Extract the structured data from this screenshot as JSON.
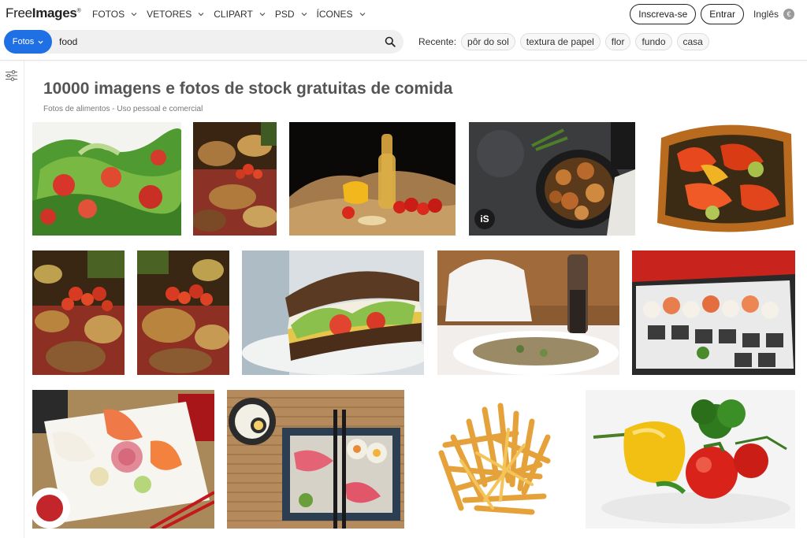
{
  "header": {
    "logo_light": "Free",
    "logo_bold": "Images",
    "logo_mark": "®",
    "nav": [
      {
        "label": "FOTOS",
        "has_menu": true
      },
      {
        "label": "VETORES",
        "has_menu": true
      },
      {
        "label": "CLIPART",
        "has_menu": true
      },
      {
        "label": "PSD",
        "has_menu": true
      },
      {
        "label": "ÍCONES",
        "has_menu": true
      }
    ],
    "signup_label": "Inscreva-se",
    "login_label": "Entrar",
    "language_label": "Inglês",
    "language_icon_glyph": "€"
  },
  "search": {
    "type_label": "Fotos",
    "query": "food",
    "icon": "search-icon",
    "recent_label": "Recente:",
    "recent_tags": [
      "pôr do sol",
      "textura de papel",
      "flor",
      "fundo",
      "casa"
    ]
  },
  "main": {
    "title": "10000 imagens e fotos de stock gratuitas de comida",
    "subtitle": "Fotos de alimentos - Uso pessoal e comercial"
  },
  "gallery": [
    {
      "name": "salad",
      "badge": ""
    },
    {
      "name": "buffet-table",
      "badge": ""
    },
    {
      "name": "oil-and-vegetables",
      "badge": ""
    },
    {
      "name": "chicken-pan",
      "badge": "iS"
    },
    {
      "name": "roasted-peppers",
      "badge": ""
    },
    {
      "name": "buffet-table-2",
      "badge": ""
    },
    {
      "name": "buffet-table-3",
      "badge": ""
    },
    {
      "name": "sandwich",
      "badge": ""
    },
    {
      "name": "soup-teapot",
      "badge": ""
    },
    {
      "name": "sushi-platter",
      "badge": ""
    },
    {
      "name": "sashimi-plate",
      "badge": ""
    },
    {
      "name": "sushi-bamboo",
      "badge": ""
    },
    {
      "name": "french-fries",
      "badge": ""
    },
    {
      "name": "pepper-tomato",
      "badge": ""
    }
  ],
  "colors": {
    "accent": "#1f6fe5",
    "title": "#555555"
  }
}
